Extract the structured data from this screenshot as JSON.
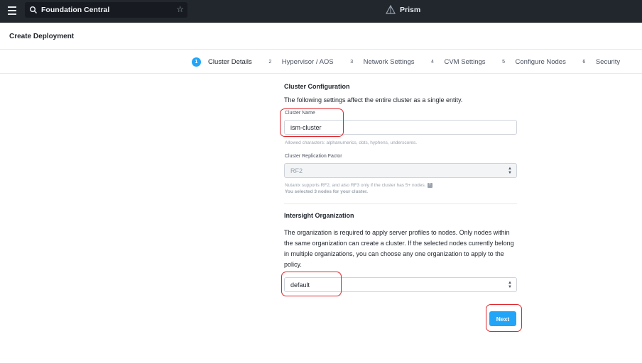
{
  "topbar": {
    "search_value": "Foundation Central",
    "product_name": "Prism"
  },
  "page": {
    "title": "Create Deployment"
  },
  "steps": [
    {
      "num": "1",
      "label": "Cluster Details",
      "active": true
    },
    {
      "num": "2",
      "label": "Hypervisor / AOS",
      "active": false
    },
    {
      "num": "3",
      "label": "Network Settings",
      "active": false
    },
    {
      "num": "4",
      "label": "CVM Settings",
      "active": false
    },
    {
      "num": "5",
      "label": "Configure Nodes",
      "active": false
    },
    {
      "num": "6",
      "label": "Security",
      "active": false
    }
  ],
  "cluster_config": {
    "title": "Cluster Configuration",
    "description": "The following settings affect the entire cluster as a single entity.",
    "name_label": "Cluster Name",
    "name_value": "ism-cluster",
    "name_help": "Allowed characters: alphanumerics, dots, hyphens, underscores.",
    "rf_label": "Cluster Replication Factor",
    "rf_value": "RF2",
    "rf_help_1": "Nutanix supports RF2, and also RF3 only if the cluster has 5+ nodes.",
    "rf_help_2": "You selected 3 nodes for your cluster."
  },
  "intersight": {
    "title": "Intersight Organization",
    "description_lines": [
      "The organization is required to apply server profiles to nodes. Only nodes within",
      "the same organization can create a cluster. If the selected nodes currently belong",
      "in multiple organizations, you can choose any one organization to apply to the",
      "policy."
    ],
    "org_value": "default"
  },
  "actions": {
    "next_label": "Next"
  },
  "colors": {
    "accent": "#22a5f7",
    "topbar": "#22272e",
    "highlight": "#e0262b"
  }
}
